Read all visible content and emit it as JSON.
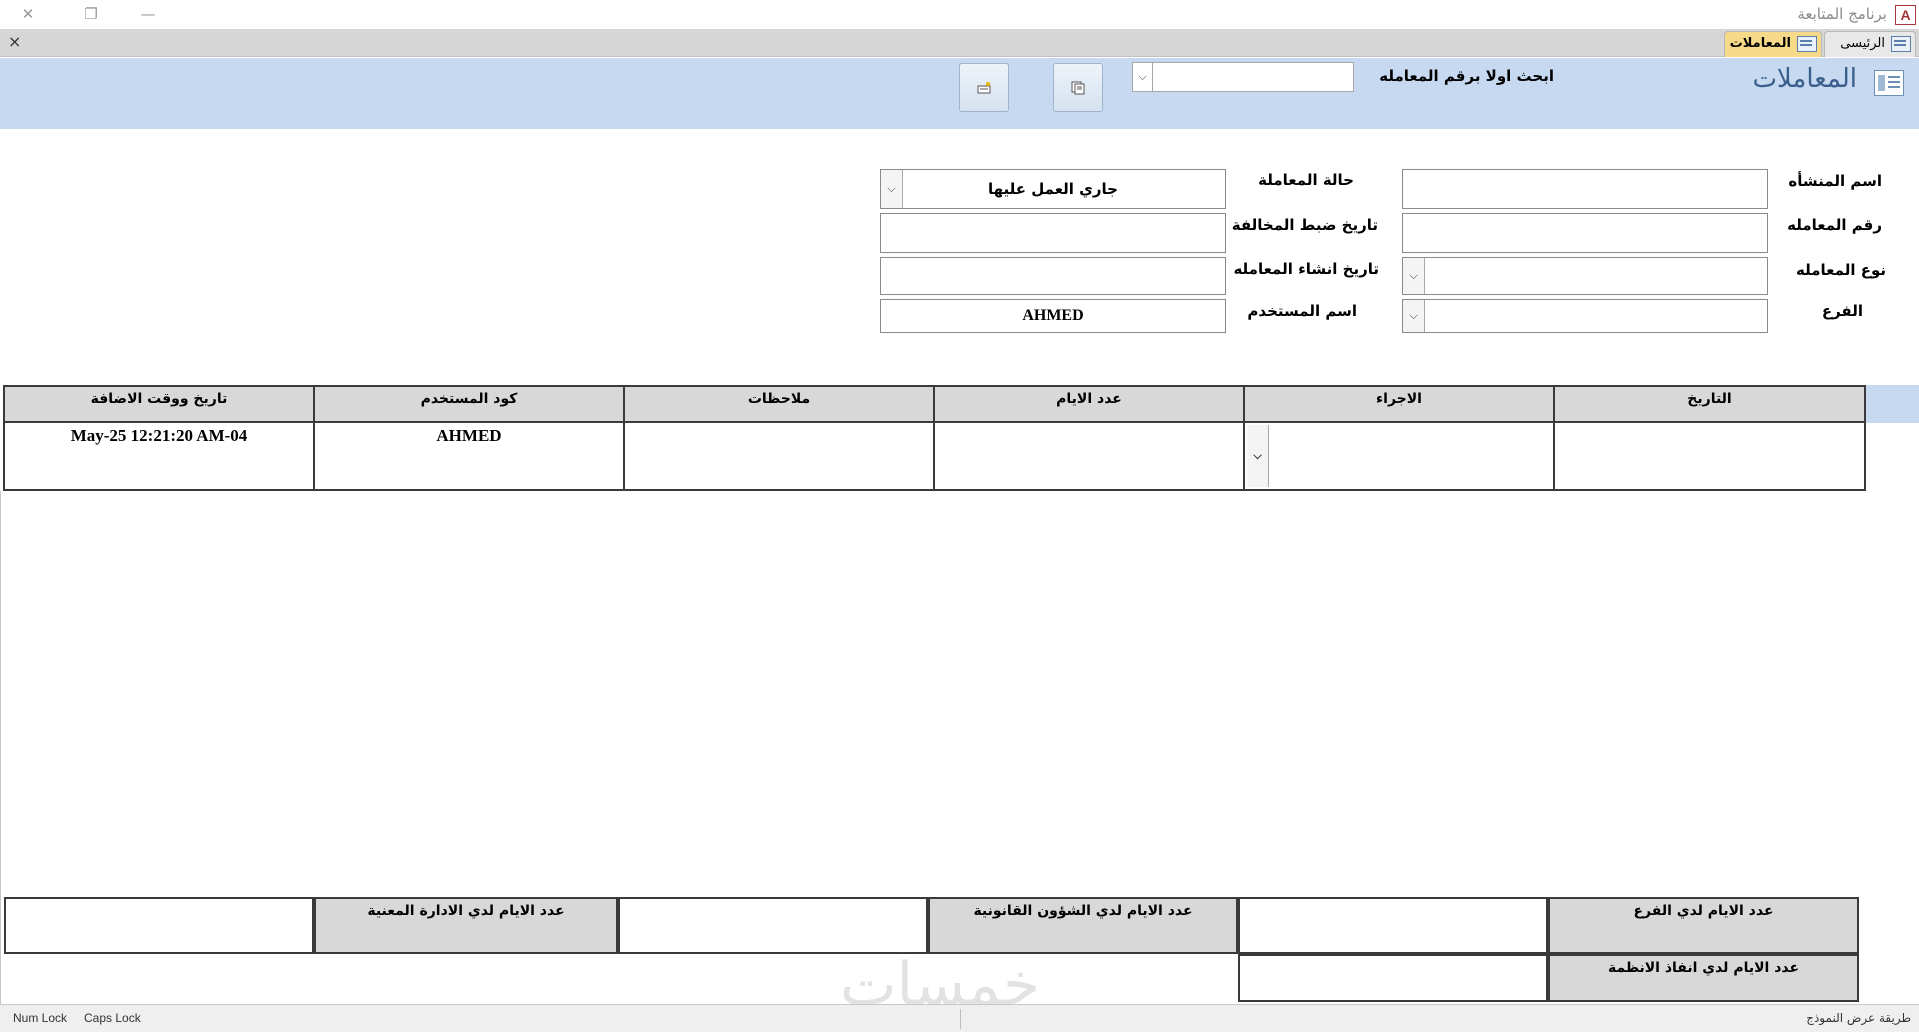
{
  "window": {
    "title": "برنامج المتابعة",
    "icon_letter": "A",
    "minimize_glyph": "—",
    "restore_glyph": "❐",
    "close_glyph": "✕"
  },
  "tabs": [
    {
      "label": "الرئيسى",
      "active": false
    },
    {
      "label": "المعاملات",
      "active": true
    }
  ],
  "tab_close_glyph": "×",
  "header": {
    "title": "المعاملات",
    "search_label": "ابحث اولا برقم المعامله",
    "search_value": "",
    "dropdown_glyph": "⌵"
  },
  "fields": {
    "establishment_name": {
      "label": "اسم المنشأه",
      "value": ""
    },
    "transaction_number": {
      "label": "رقم المعامله",
      "value": ""
    },
    "transaction_type": {
      "label": "نوع المعامله",
      "value": ""
    },
    "branch": {
      "label": "الفرع",
      "value": ""
    },
    "transaction_status": {
      "label": "حالة المعاملة",
      "value": "جاري العمل عليها"
    },
    "violation_date": {
      "label": "تاريخ ضبط المخالفة",
      "value": ""
    },
    "creation_date": {
      "label": "تاريخ انشاء المعامله",
      "value": ""
    },
    "username": {
      "label": "اسم المستخدم",
      "value": "AHMED"
    }
  },
  "grid": {
    "columns": [
      "التاريخ",
      "الاجراء",
      "عدد الايام",
      "ملاحظات",
      "كود المستخدم",
      "تاريخ ووقت الاضافة"
    ],
    "rows": [
      {
        "date": "",
        "action": "",
        "days": "",
        "notes": "",
        "user_code": "AHMED",
        "added_at": "May-25 12:21:20 AM-04"
      }
    ]
  },
  "totals": {
    "branch_days": {
      "label": "عدد الايام لدي الفرع",
      "value": ""
    },
    "legal_days": {
      "label": "عدد الايام لدي الشؤون القانونية",
      "value": ""
    },
    "admin_days": {
      "label": "عدد الايام لدي الادارة المعنية",
      "value": ""
    },
    "enforcement_days": {
      "label": "عدد الايام لدي انفاذ الانظمة",
      "value": ""
    }
  },
  "watermark": "خمسات",
  "statusbar": {
    "view_mode": "طريقة عرض النموذج",
    "num_lock": "Num Lock",
    "caps_lock": "Caps Lock"
  },
  "colors": {
    "header_bg": "#c6d9f1",
    "active_tab": "#f7d98a",
    "title_blue": "#3b5f8d",
    "access_red": "#a4373a"
  }
}
